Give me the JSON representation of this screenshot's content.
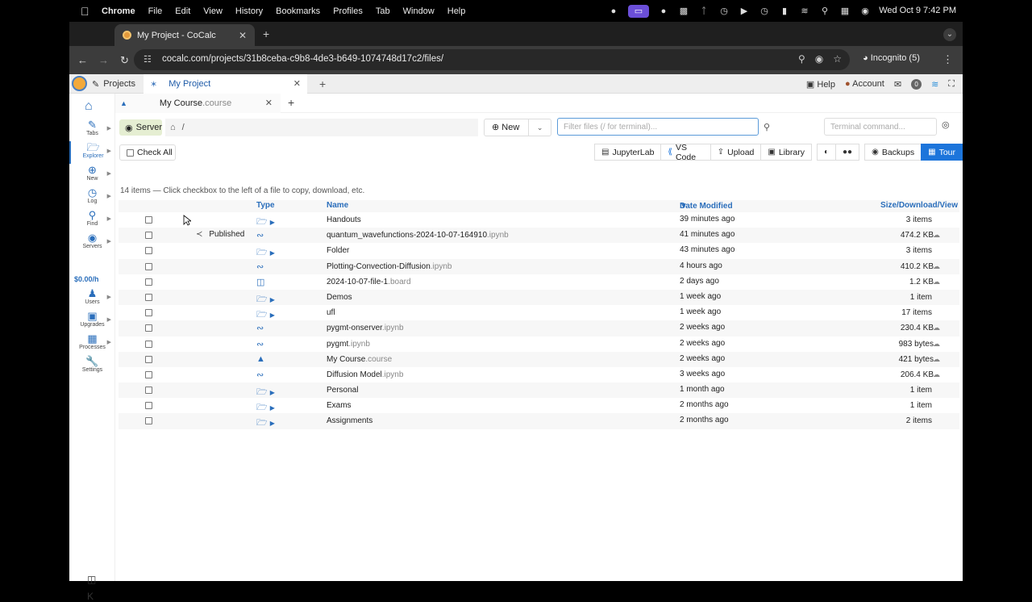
{
  "menubar": {
    "app": "Chrome",
    "items": [
      "File",
      "Edit",
      "View",
      "History",
      "Bookmarks",
      "Profiles",
      "Tab",
      "Window",
      "Help"
    ],
    "clock": "Wed Oct 9  7:42 PM"
  },
  "browser": {
    "tab_title": "My Project - CoCalc",
    "url": "cocalc.com/projects/31b8ceba-c9b8-4de3-b649-1074748d17c2/files/",
    "incognito": "Incognito (5)"
  },
  "topbar": {
    "projects": "Projects",
    "project_tab": "My Project",
    "help": "Help",
    "account": "Account",
    "notifications": "0"
  },
  "sidebar": {
    "items": [
      "Tabs",
      "Explorer",
      "New",
      "Log",
      "Find",
      "Servers",
      "Users",
      "Upgrades",
      "Processes",
      "Settings"
    ],
    "cost": "$0.00/h"
  },
  "filetabs": {
    "name": "My Course",
    "ext": ".course"
  },
  "explorer": {
    "server": "Server",
    "path": "/",
    "new_label": "New",
    "filter_placeholder": "Filter files (/ for terminal)...",
    "terminal_placeholder": "Terminal command...",
    "check_all": "Check All",
    "buttons": [
      "JupyterLab",
      "VS Code",
      "Upload",
      "Library",
      "Backups",
      "Tour"
    ],
    "summary": "14 items — Click checkbox to the left of a file to copy, download, etc.",
    "columns": {
      "type": "Type",
      "name": "Name",
      "date": "Date Modified",
      "size": "Size/Download/View"
    },
    "published": "Published",
    "files": [
      {
        "kind": "folder",
        "name": "Handouts",
        "ext": "",
        "date": "39 minutes ago",
        "size": "3 items"
      },
      {
        "kind": "notebook",
        "name": "quantum_wavefunctions-2024-10-07-164910",
        "ext": ".ipynb",
        "date": "41 minutes ago",
        "size": "474.2 KB"
      },
      {
        "kind": "folder",
        "name": "Folder",
        "ext": "",
        "date": "43 minutes ago",
        "size": "3 items"
      },
      {
        "kind": "notebook",
        "name": "Plotting-Convection-Diffusion",
        "ext": ".ipynb",
        "date": "4 hours ago",
        "size": "410.2 KB"
      },
      {
        "kind": "board",
        "name": "2024-10-07-file-1",
        "ext": ".board",
        "date": "2 days ago",
        "size": "1.2 KB"
      },
      {
        "kind": "folder",
        "name": "Demos",
        "ext": "",
        "date": "1 week ago",
        "size": "1 item"
      },
      {
        "kind": "folder",
        "name": "ufl",
        "ext": "",
        "date": "1 week ago",
        "size": "17 items"
      },
      {
        "kind": "notebook",
        "name": "pygmt-onserver",
        "ext": ".ipynb",
        "date": "2 weeks ago",
        "size": "230.4 KB"
      },
      {
        "kind": "notebook",
        "name": "pygmt",
        "ext": ".ipynb",
        "date": "2 weeks ago",
        "size": "983 bytes"
      },
      {
        "kind": "course",
        "name": "My Course",
        "ext": ".course",
        "date": "2 weeks ago",
        "size": "421 bytes"
      },
      {
        "kind": "notebook",
        "name": "Diffusion Model",
        "ext": ".ipynb",
        "date": "3 weeks ago",
        "size": "206.4 KB"
      },
      {
        "kind": "folder",
        "name": "Personal",
        "ext": "",
        "date": "1 month ago",
        "size": "1 item"
      },
      {
        "kind": "folder",
        "name": "Exams",
        "ext": "",
        "date": "2 months ago",
        "size": "1 item"
      },
      {
        "kind": "folder",
        "name": "Assignments",
        "ext": "",
        "date": "2 months ago",
        "size": "2 items"
      }
    ]
  }
}
